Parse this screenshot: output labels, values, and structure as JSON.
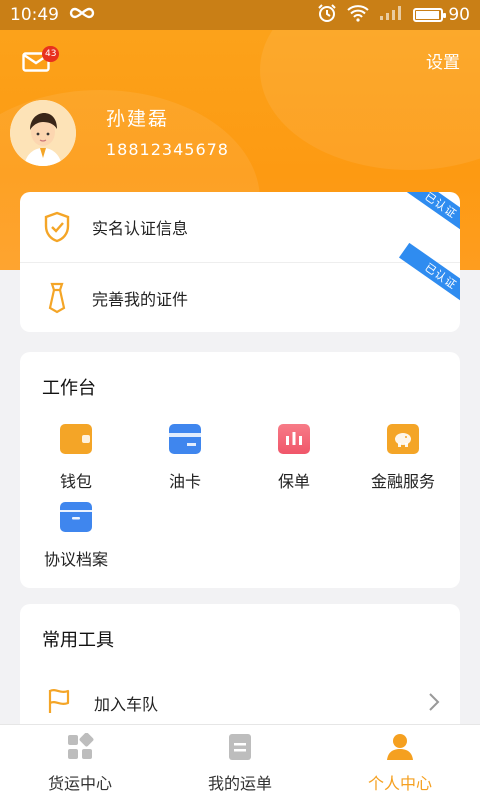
{
  "status_bar": {
    "time": "10:49",
    "battery": "90"
  },
  "header": {
    "mail_badge": "43",
    "settings_label": "设置",
    "user_name": "孙建磊",
    "user_phone": "18812345678"
  },
  "verification": {
    "items": [
      {
        "label": "实名认证信息",
        "badge": "已认证"
      },
      {
        "label": "完善我的证件",
        "badge": "已认证"
      }
    ]
  },
  "workbench": {
    "title": "工作台",
    "items": [
      {
        "label": "钱包",
        "icon": "wallet-icon",
        "color": "#f4a527"
      },
      {
        "label": "油卡",
        "icon": "card-icon",
        "color": "#3f86ee"
      },
      {
        "label": "保单",
        "icon": "policy-icon",
        "color": "#f0566a"
      },
      {
        "label": "金融服务",
        "icon": "piggy-bank-icon",
        "color": "#f4a527"
      },
      {
        "label": "协议档案",
        "icon": "archive-box-icon",
        "color": "#3f86ee"
      }
    ]
  },
  "tools": {
    "title": "常用工具",
    "items": [
      {
        "label": "加入车队",
        "icon": "flag-icon"
      }
    ]
  },
  "bottom_nav": {
    "items": [
      {
        "label": "货运中心",
        "icon": "grid-icon",
        "active": false
      },
      {
        "label": "我的运单",
        "icon": "document-icon",
        "active": false
      },
      {
        "label": "个人中心",
        "icon": "person-icon",
        "active": true
      }
    ]
  },
  "colors": {
    "accent": "#fd9a12",
    "verified_ribbon": "#2f8cf0",
    "active_tab": "#f5a020"
  }
}
